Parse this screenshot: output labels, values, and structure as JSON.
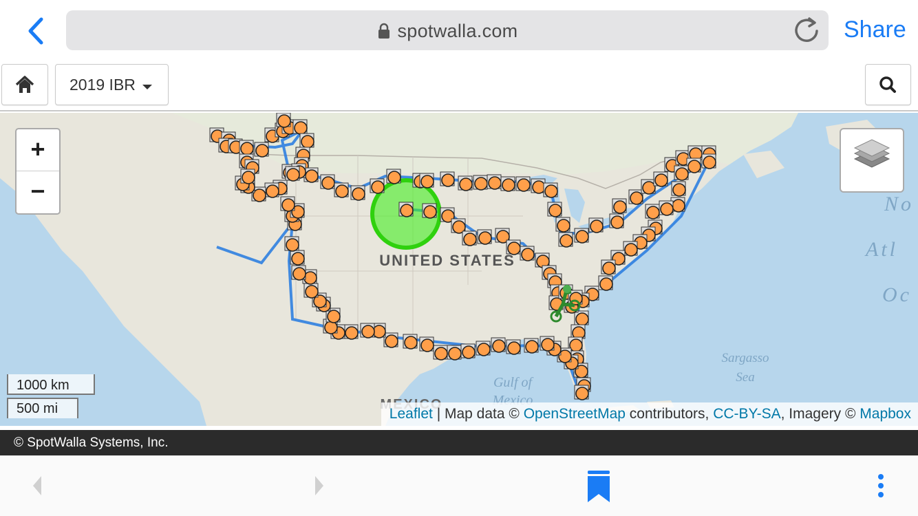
{
  "browser": {
    "url": "spotwalla.com",
    "share_label": "Share",
    "icons": [
      "back-chevron-icon",
      "lock-icon",
      "reload-icon"
    ]
  },
  "toolbar": {
    "dropdown_label": "2019 IBR",
    "icons": [
      "home-icon",
      "caret-down-icon",
      "search-icon"
    ]
  },
  "map": {
    "labels": {
      "country_us": "UNITED STATES",
      "mexico": "MEXICO",
      "gulf_1": "Gulf of",
      "gulf_2": "Mexico",
      "sargasso_1": "Sargasso",
      "sargasso_2": "Sea",
      "atlantic_1": "No",
      "atlantic_2": "Atl",
      "atlantic_3": "Oc"
    },
    "zoom_in": "+",
    "zoom_out": "−",
    "scale_km": "1000 km",
    "scale_mi": "500 mi",
    "attribution": {
      "leaflet": "Leaflet",
      "sep_1": " | Map data © ",
      "osm": "OpenStreetMap",
      "sep_2": " contributors, ",
      "license": "CC-BY-SA",
      "sep_3": ", Imagery © ",
      "mapbox": "Mapbox"
    },
    "colors": {
      "water": "#b7d6ec",
      "land": "#e8e6dc",
      "marker": "#ff9f4a",
      "route": "#2f7fe0",
      "highlight": "#44ee22"
    }
  },
  "footer": {
    "copyright": "© SpotWalla Systems, Inc."
  },
  "bottom_nav": {
    "icons": [
      "nav-back-icon",
      "nav-forward-icon",
      "bookmark-icon",
      "more-vertical-icon"
    ]
  }
}
